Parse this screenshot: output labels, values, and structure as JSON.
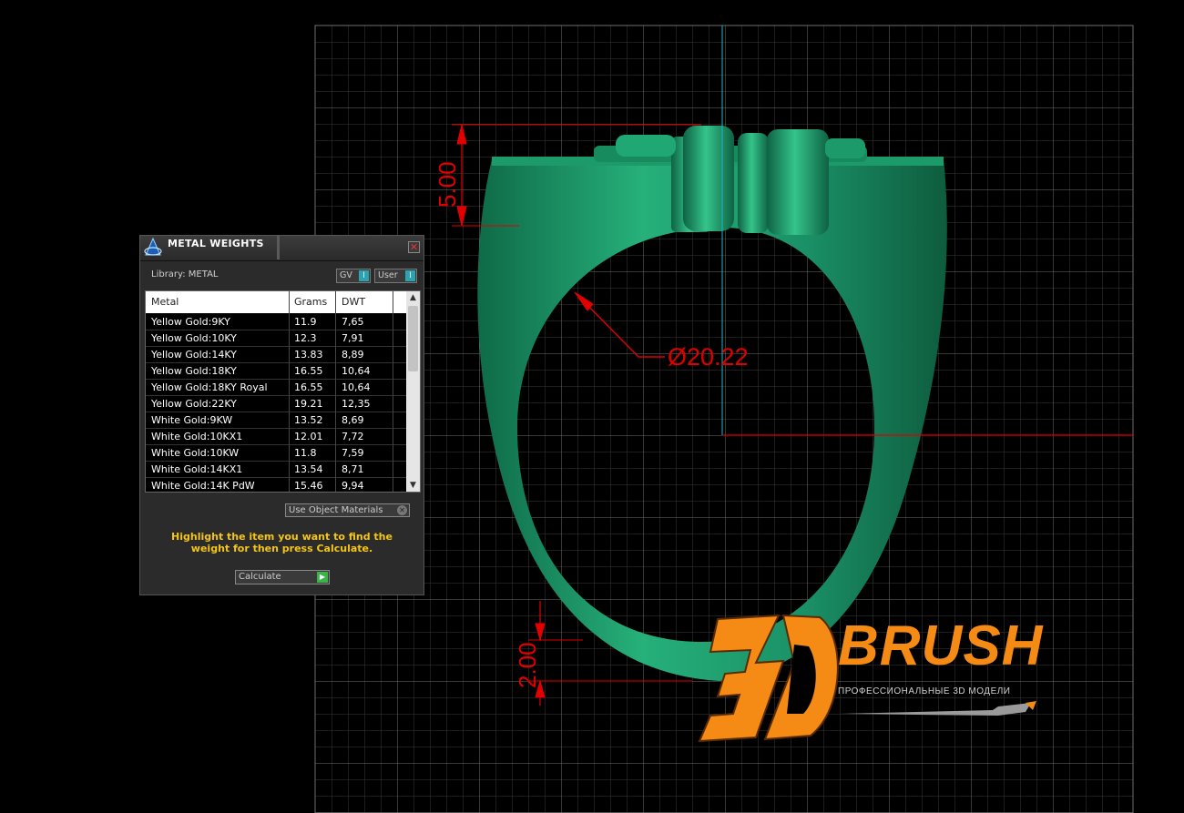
{
  "colors": {
    "ring": "#1fa06f",
    "grid": "#5a5a5a",
    "dimension": "#e00000",
    "axis_vertical": "#1ab8c8",
    "panel_bg": "#2b2b2b",
    "brand": "#f58a14",
    "instructions": "#f5c518"
  },
  "viewport": {
    "dimensions": {
      "top_height": "5.00",
      "inner_diameter": "Ø20.22",
      "bottom_thickness": "2.00"
    }
  },
  "panel": {
    "title": "METAL WEIGHTS",
    "library_label": "Library: METAL",
    "toggles": {
      "gv": "GV",
      "user": "User",
      "knob": "I"
    },
    "close_icon": "✕",
    "columns": {
      "metal": "Metal",
      "grams": "Grams",
      "dwt": "DWT"
    },
    "rows": [
      {
        "metal": "Yellow Gold:9KY",
        "grams": "11.9",
        "dwt": "7,65"
      },
      {
        "metal": "Yellow Gold:10KY",
        "grams": "12.3",
        "dwt": "7,91"
      },
      {
        "metal": "Yellow Gold:14KY",
        "grams": "13.83",
        "dwt": "8,89"
      },
      {
        "metal": "Yellow Gold:18KY",
        "grams": "16.55",
        "dwt": "10,64"
      },
      {
        "metal": "Yellow Gold:18KY Royal",
        "grams": "16.55",
        "dwt": "10,64"
      },
      {
        "metal": "Yellow Gold:22KY",
        "grams": "19.21",
        "dwt": "12,35"
      },
      {
        "metal": "White Gold:9KW",
        "grams": "13.52",
        "dwt": "8,69"
      },
      {
        "metal": "White Gold:10KX1",
        "grams": "12.01",
        "dwt": "7,72"
      },
      {
        "metal": "White Gold:10KW",
        "grams": "11.8",
        "dwt": "7,59"
      },
      {
        "metal": "White Gold:14KX1",
        "grams": "13.54",
        "dwt": "8,71"
      },
      {
        "metal": "White Gold:14K PdW",
        "grams": "15.46",
        "dwt": "9,94"
      }
    ],
    "use_object_materials": "Use Object Materials",
    "instructions": "Highlight the item you want to find the weight for then press Calculate.",
    "calculate_label": "Calculate",
    "scroll_up": "▲",
    "scroll_down": "▼"
  },
  "brand": {
    "logo_text": "3D BRUSH",
    "subtitle": "ПРОФЕССИОНАЛЬНЫЕ 3D МОДЕЛИ"
  }
}
